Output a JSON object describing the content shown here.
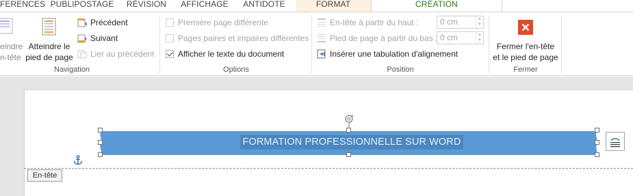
{
  "tabs": {
    "references": "FERENCES",
    "publipostage": "PUBLIPOSTAGE",
    "revision": "RÉVISION",
    "affichage": "AFFICHAGE",
    "antidote": "ANTIDOTE",
    "format": "FORMAT",
    "creation": "CRÉATION"
  },
  "navigation": {
    "atteindre_entete_line1": "eindre",
    "atteindre_entete_line2": "n-tête",
    "atteindre_pied_line1": "Atteindre le",
    "atteindre_pied_line2": "pied de page",
    "precedent": "Précédent",
    "suivant": "Suivant",
    "lier": "Lier au précédent",
    "label": "Navigation"
  },
  "options": {
    "premiere_page": "Première page différente",
    "pages_paires": "Pages paires et impaires différentes",
    "afficher_texte": "Afficher le texte du document",
    "label": "Options"
  },
  "position": {
    "entete_haut": "En-tête à partir du haut :",
    "entete_haut_value": "0 cm",
    "pied_bas": "Pied de page à partir du bas :",
    "pied_bas_value": "0 cm",
    "inserer_tab": "Insérer une tabulation d'alignement",
    "label": "Position"
  },
  "fermer": {
    "line1": "Fermer l'en-tête",
    "line2": "et le pied de page",
    "label": "Fermer"
  },
  "document": {
    "banner_text": "FORMATION PROFESSIONNELLE SUR WORD",
    "entete_tag": "En-tête"
  },
  "colors": {
    "accent_green": "#2b7a0b",
    "banner_blue": "#5b9bd5",
    "close_red": "#e04a2f"
  }
}
